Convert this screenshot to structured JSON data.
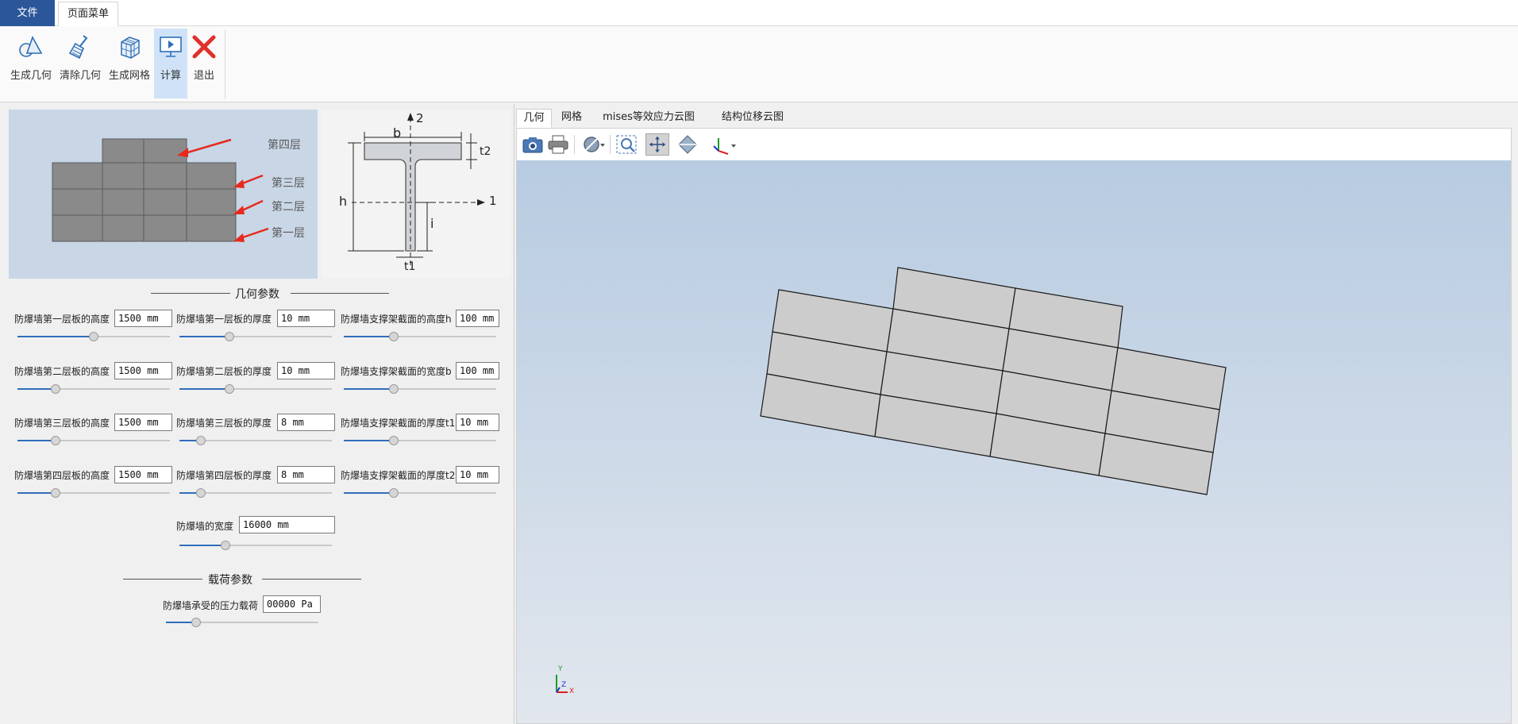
{
  "ribbon": {
    "tabs": [
      {
        "label": "文件",
        "active": false,
        "color": "#2b579a"
      },
      {
        "label": "页面菜单",
        "active": true
      }
    ],
    "buttons": [
      {
        "label": "生成几何",
        "icon": "shapes-icon"
      },
      {
        "label": "清除几何",
        "icon": "broom-icon"
      },
      {
        "label": "生成网格",
        "icon": "mesh-cube-icon"
      },
      {
        "label": "计算",
        "icon": "monitor-play-icon",
        "active": true
      },
      {
        "label": "退出",
        "icon": "red-x-icon"
      }
    ]
  },
  "layers_image": {
    "labels": [
      "第四层",
      "第三层",
      "第二层",
      "第一层"
    ]
  },
  "tbeam_image": {
    "labels": {
      "axis2": "2",
      "axis1": "1",
      "b": "b",
      "t2": "t2",
      "h": "h",
      "i": "i",
      "t1": "t1"
    }
  },
  "geometry": {
    "title": "几何参数",
    "params": [
      {
        "label": "防爆墙第一层板的高度",
        "value": "1500 mm",
        "slider": 0.5
      },
      {
        "label": "防爆墙第一层板的厚度",
        "value": "10 mm",
        "slider": 0.33
      },
      {
        "label": "防爆墙支撑架截面的高度h",
        "value": "100 mm",
        "slider": 0.33
      },
      {
        "label": "防爆墙第二层板的高度",
        "value": "1500 mm",
        "slider": 0.25
      },
      {
        "label": "防爆墙第二层板的厚度",
        "value": "10 mm",
        "slider": 0.33
      },
      {
        "label": "防爆墙支撑架截面的宽度b",
        "value": "100 mm",
        "slider": 0.33
      },
      {
        "label": "防爆墙第三层板的高度",
        "value": "1500 mm",
        "slider": 0.25
      },
      {
        "label": "防爆墙第三层板的厚度",
        "value": "8 mm",
        "slider": 0.14
      },
      {
        "label": "防爆墙支撑架截面的厚度t1",
        "value": "10 mm",
        "slider": 0.33
      },
      {
        "label": "防爆墙第四层板的高度",
        "value": "1500 mm",
        "slider": 0.25
      },
      {
        "label": "防爆墙第四层板的厚度",
        "value": "8 mm",
        "slider": 0.14
      },
      {
        "label": "防爆墙支撑架截面的厚度t2",
        "value": "10 mm",
        "slider": 0.33
      }
    ],
    "width_param": {
      "label": "防爆墙的宽度",
      "value": "16000 mm",
      "slider": 0.3
    }
  },
  "load": {
    "title": "载荷参数",
    "pressure_param": {
      "label": "防爆墙承受的压力载荷",
      "value": "00000 Pa",
      "slider": 0.2
    }
  },
  "viewer": {
    "tabs": [
      {
        "label": "几何",
        "active": true
      },
      {
        "label": "网格"
      },
      {
        "label": "mises等效应力云图"
      },
      {
        "label": "结构位移云图"
      }
    ],
    "toolbar_icons": [
      "camera-icon",
      "print-icon",
      "clip-icon",
      "zoom-box-icon",
      "pan-icon",
      "fit-view-icon",
      "axes-icon"
    ],
    "axis_labels": {
      "x": "X",
      "y": "Y",
      "z": "Z"
    },
    "background_top": "#b7cbe1",
    "background_bottom": "#e2e7ee",
    "panel_fill": "#cccccc"
  }
}
